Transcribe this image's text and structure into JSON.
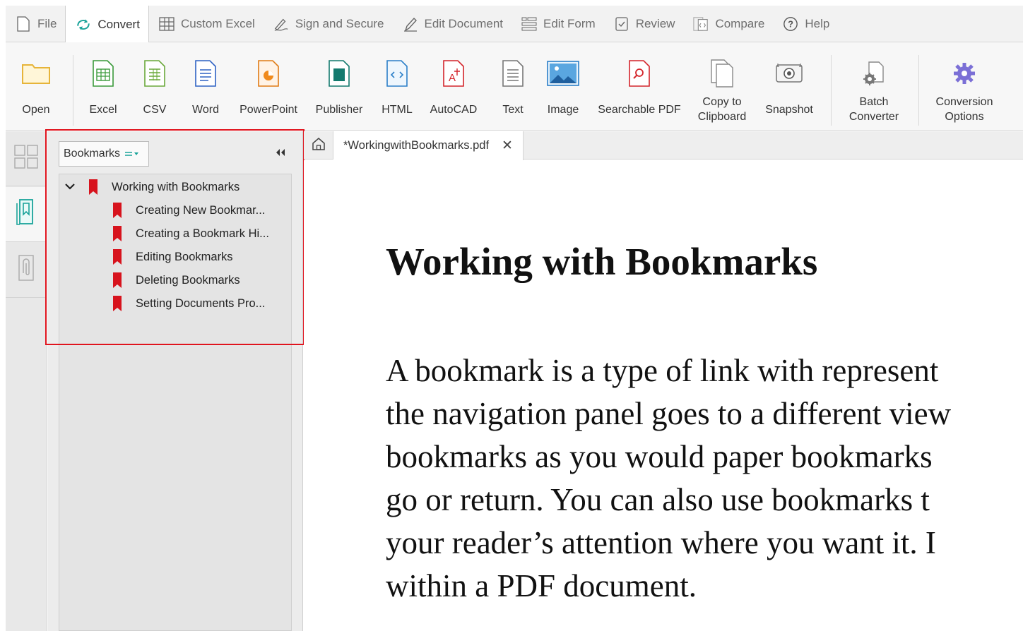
{
  "menu": {
    "tabs": [
      {
        "label": "File",
        "icon": "file-icon"
      },
      {
        "label": "Convert",
        "icon": "convert-icon",
        "active": true
      },
      {
        "label": "Custom Excel",
        "icon": "grid-icon"
      },
      {
        "label": "Sign and Secure",
        "icon": "pen-icon"
      },
      {
        "label": "Edit Document",
        "icon": "edit-icon"
      },
      {
        "label": "Edit Form",
        "icon": "form-icon"
      },
      {
        "label": "Review",
        "icon": "review-icon"
      },
      {
        "label": "Compare",
        "icon": "compare-icon"
      },
      {
        "label": "Help",
        "icon": "help-icon"
      }
    ]
  },
  "ribbon": {
    "open": "Open",
    "excel": "Excel",
    "csv": "CSV",
    "word": "Word",
    "powerpoint": "PowerPoint",
    "publisher": "Publisher",
    "html": "HTML",
    "autocad": "AutoCAD",
    "text": "Text",
    "image": "Image",
    "searchable_pdf": "Searchable PDF",
    "copy_line1": "Copy to",
    "copy_line2": "Clipboard",
    "snapshot": "Snapshot",
    "batch_line1": "Batch",
    "batch_line2": "Converter",
    "conv_line1": "Conversion",
    "conv_line2": "Options"
  },
  "panel": {
    "dropdown_label": "Bookmarks",
    "root": "Working with Bookmarks",
    "children": [
      "Creating New Bookmar...",
      "Creating a Bookmark Hi...",
      "Editing Bookmarks",
      "Deleting Bookmarks",
      "Setting Documents Pro..."
    ]
  },
  "document": {
    "tab_title": "*WorkingwithBookmarks.pdf",
    "close_glyph": "✕",
    "heading": "Working with Bookmarks",
    "lines": [
      "A bookmark is a type of link with represent",
      "the navigation panel goes to a different view",
      "bookmarks as you would paper bookmarks",
      "go or return. You can also use bookmarks t",
      "your reader’s attention where you want it. I",
      "within a PDF document."
    ]
  },
  "colors": {
    "accent_teal": "#1aa39a",
    "bookmark_red": "#d7131d",
    "highlight_red": "#e0141e",
    "conversion_purple": "#7b6fd6"
  }
}
